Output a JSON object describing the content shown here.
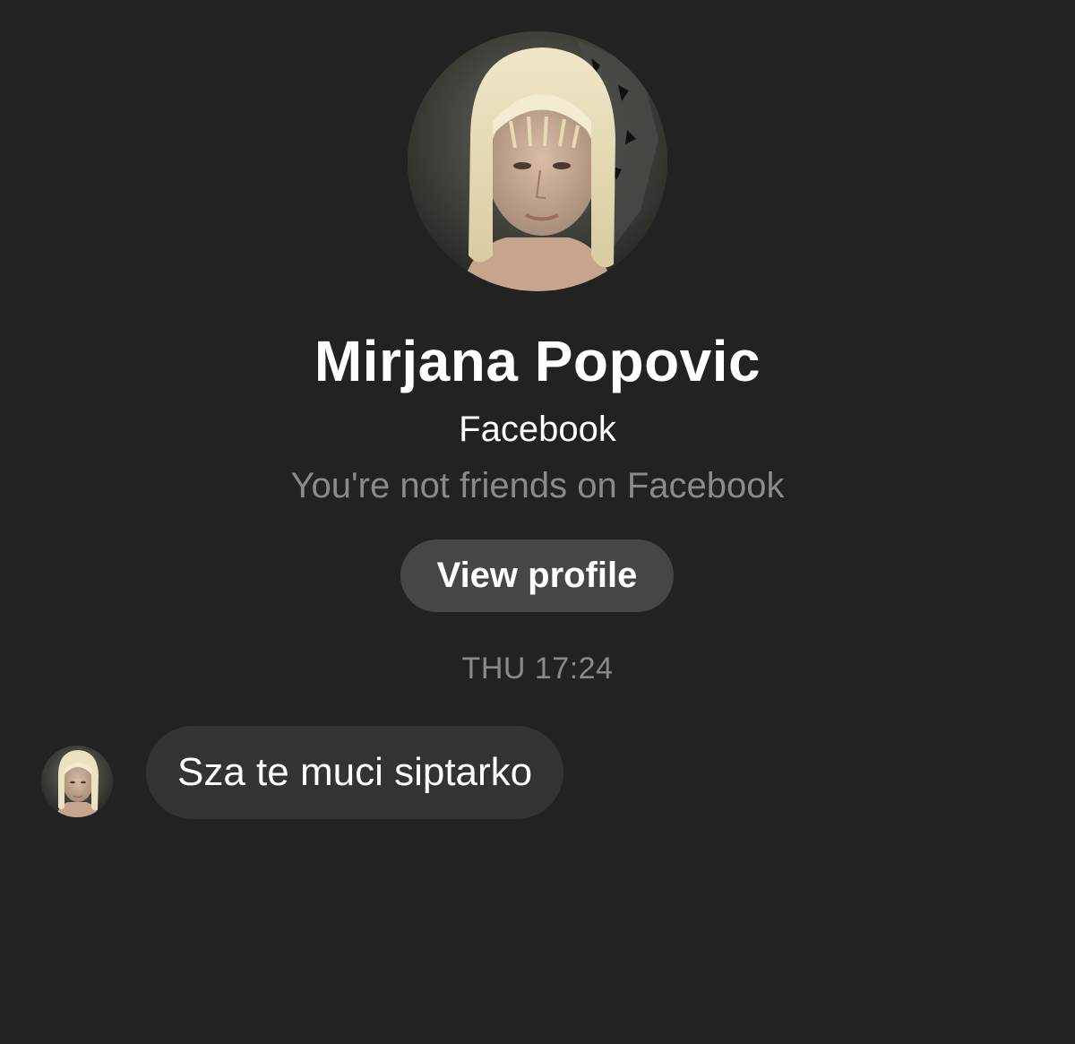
{
  "contact": {
    "name": "Mirjana Popovic",
    "platform": "Facebook",
    "friend_status": "You're not friends on Facebook",
    "avatar_icon": "profile-photo"
  },
  "actions": {
    "view_profile_label": "View profile"
  },
  "conversation": {
    "timestamp": "THU 17:24",
    "messages": [
      {
        "sender": "Mirjana Popovic",
        "text": "Sza te muci siptarko"
      }
    ]
  },
  "colors": {
    "background": "#222222",
    "button": "#464646",
    "bubble": "#333333",
    "muted_text": "#8a8a8a",
    "primary_text": "#ffffff"
  }
}
